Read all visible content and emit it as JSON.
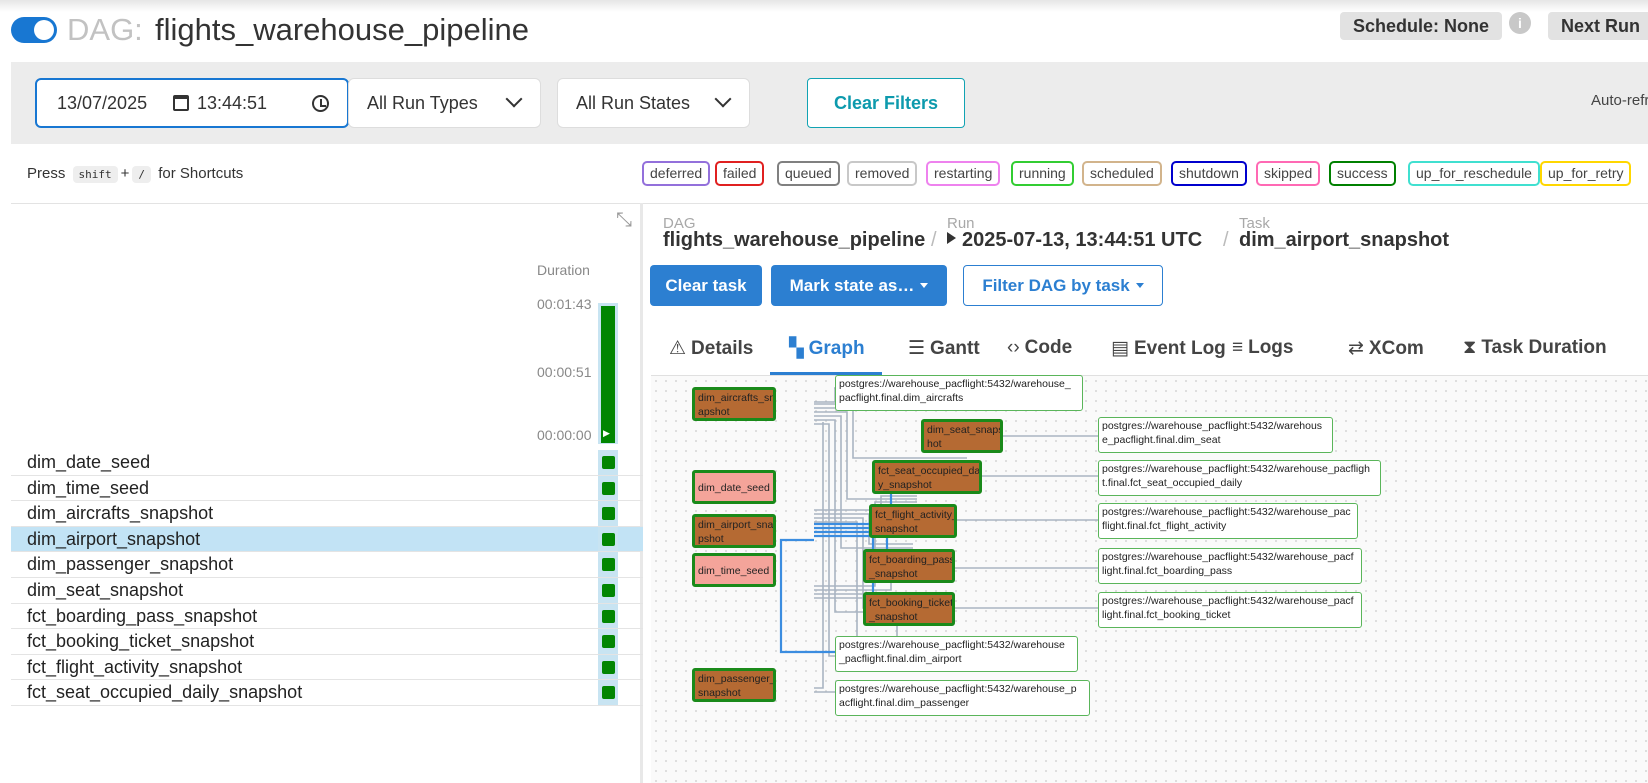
{
  "header": {
    "dag_prefix": "DAG:",
    "dag_name": "flights_warehouse_pipeline",
    "schedule": "Schedule: None",
    "info_icon": "i",
    "next_run": "Next Run"
  },
  "filters": {
    "date": "13/07/2025",
    "time": "13:44:51",
    "run_types": "All Run Types",
    "run_states": "All Run States",
    "clear": "Clear Filters",
    "auto_refresh": "Auto-refresh"
  },
  "shortcuts": {
    "press": "Press",
    "key1": "shift",
    "plus": "+",
    "key2": "/",
    "suffix": "for Shortcuts"
  },
  "legend": [
    {
      "label": "deferred",
      "color": "#9370db"
    },
    {
      "label": "failed",
      "color": "#e02020"
    },
    {
      "label": "queued",
      "color": "#808080"
    },
    {
      "label": "removed",
      "color": "#c8c8c8"
    },
    {
      "label": "restarting",
      "color": "#ee82ee"
    },
    {
      "label": "running",
      "color": "#32cd32"
    },
    {
      "label": "scheduled",
      "color": "#d2b48c"
    },
    {
      "label": "shutdown",
      "color": "#0000cd"
    },
    {
      "label": "skipped",
      "color": "#ff69b4"
    },
    {
      "label": "success",
      "color": "#008000"
    },
    {
      "label": "up_for_reschedule",
      "color": "#40e0d0"
    },
    {
      "label": "up_for_retry",
      "color": "#ffd700"
    }
  ],
  "grid": {
    "duration_label": "Duration",
    "ticks": [
      "00:01:43",
      "00:00:51",
      "00:00:00"
    ],
    "tasks": [
      {
        "name": "dim_date_seed",
        "selected": false
      },
      {
        "name": "dim_time_seed",
        "selected": false
      },
      {
        "name": "dim_aircrafts_snapshot",
        "selected": false
      },
      {
        "name": "dim_airport_snapshot",
        "selected": true
      },
      {
        "name": "dim_passenger_snapshot",
        "selected": false
      },
      {
        "name": "dim_seat_snapshot",
        "selected": false
      },
      {
        "name": "fct_boarding_pass_snapshot",
        "selected": false
      },
      {
        "name": "fct_booking_ticket_snapshot",
        "selected": false
      },
      {
        "name": "fct_flight_activity_snapshot",
        "selected": false
      },
      {
        "name": "fct_seat_occupied_daily_snapshot",
        "selected": false
      }
    ]
  },
  "breadcrumb": {
    "dag_label": "DAG",
    "dag": "flights_warehouse_pipeline",
    "run_label": "Run",
    "run": "2025-07-13, 13:44:51 UTC",
    "task_label": "Task",
    "task": "dim_airport_snapshot",
    "sep": "/"
  },
  "actions": {
    "clear_task": "Clear task",
    "mark_state": "Mark state as…",
    "filter": "Filter DAG by task"
  },
  "tabs": [
    {
      "label": "Details",
      "icon": "⚠",
      "active": false
    },
    {
      "label": "Graph",
      "icon": "▚",
      "active": true
    },
    {
      "label": "Gantt",
      "icon": "☰",
      "active": false
    },
    {
      "label": "Code",
      "icon": "‹›",
      "active": false
    },
    {
      "label": "Event Log",
      "icon": "▤",
      "active": false
    },
    {
      "label": "Logs",
      "icon": "≡",
      "active": false
    },
    {
      "label": "XCom",
      "icon": "⇄",
      "active": false
    },
    {
      "label": "Task Duration",
      "icon": "⧗",
      "active": false
    }
  ],
  "graph": {
    "tasks": {
      "dim_aircrafts": "dim_aircrafts_sn apshot",
      "dim_date": "dim_date_seed",
      "dim_airport": "dim_airport_sna pshot",
      "dim_time": "dim_time_seed",
      "dim_passenger": "dim_passenger_ snapshot",
      "dim_seat": "dim_seat_snaps hot",
      "fct_seat": "fct_seat_occupied_dail y_snapshot",
      "fct_flight": "fct_flight_activity_ snapshot",
      "fct_boarding": "fct_boarding_pass _snapshot",
      "fct_booking": "fct_booking_ticket _snapshot"
    },
    "datasets": {
      "ds_aircrafts": "postgres://warehouse_pacflight:5432/warehouse_ pacflight.final.dim_aircrafts",
      "ds_seat": "postgres://warehouse_pacflight:5432/warehous e_pacflight.final.dim_seat",
      "ds_seat_occ": "postgres://warehouse_pacflight:5432/warehouse_pacfligh t.final.fct_seat_occupied_daily",
      "ds_flight": "postgres://warehouse_pacflight:5432/warehouse_pac flight.final.fct_flight_activity",
      "ds_boarding": "postgres://warehouse_pacflight:5432/warehouse_pacf light.final.fct_boarding_pass",
      "ds_booking": "postgres://warehouse_pacflight:5432/warehouse_pacf light.final.fct_booking_ticket",
      "ds_airport": "postgres://warehouse_pacflight:5432/warehouse _pacflight.final.dim_airport",
      "ds_passenger": "postgres://warehouse_pacflight:5432/warehouse_p acflight.final.dim_passenger"
    }
  }
}
